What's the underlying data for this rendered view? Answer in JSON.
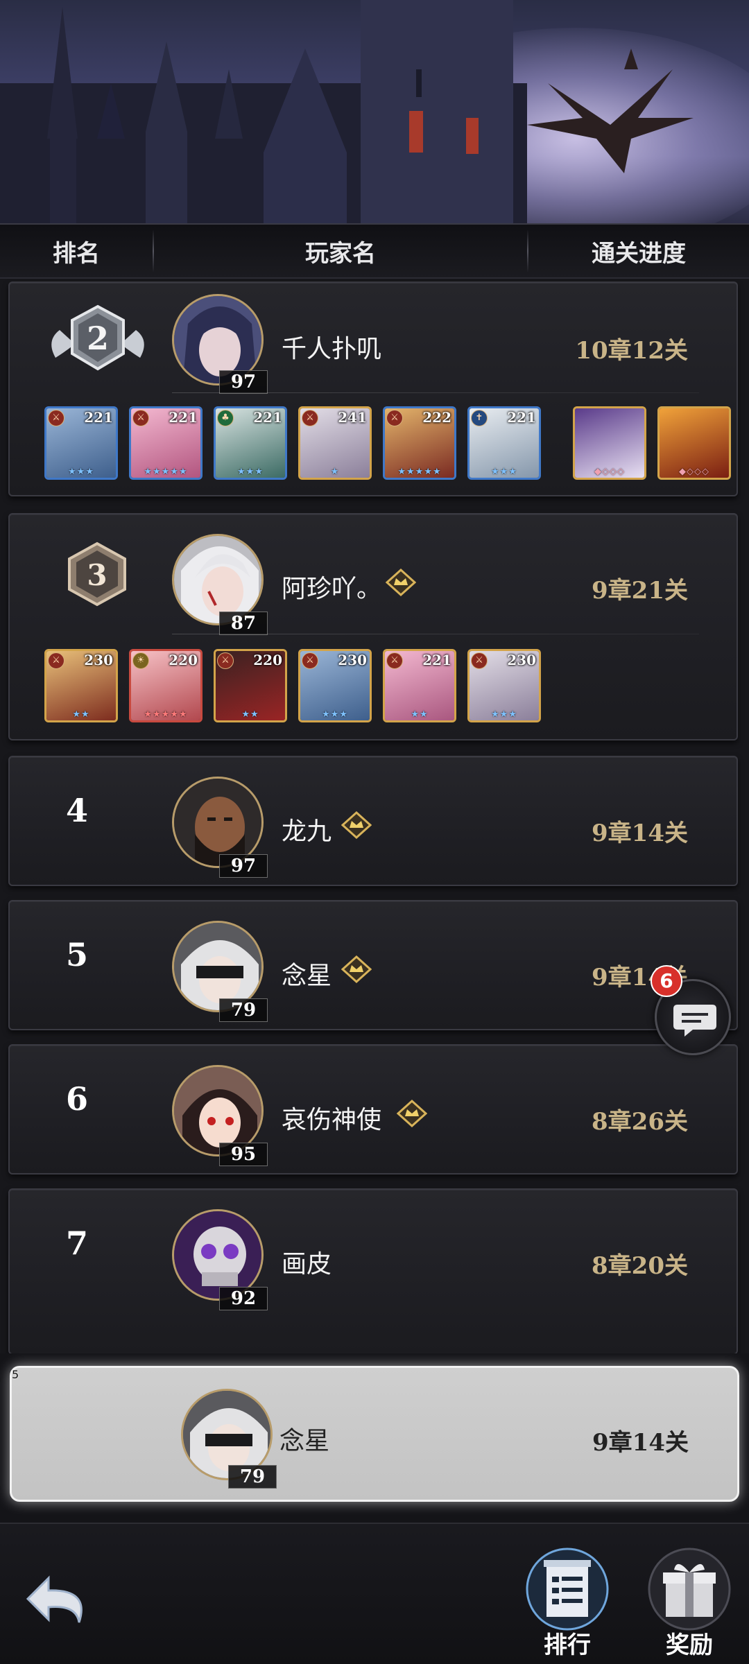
{
  "header": {
    "col_rank": "排名",
    "col_player": "玩家名",
    "col_progress": "通关进度"
  },
  "rows": [
    {
      "rank": "2",
      "name": "千人扑叽",
      "level": "97",
      "progress": "10章12关",
      "vip": false,
      "heroes": [
        {
          "lvl": "221",
          "stars": "★★★"
        },
        {
          "lvl": "221",
          "stars": "★★★★★"
        },
        {
          "lvl": "221",
          "stars": "★★★"
        },
        {
          "lvl": "241",
          "stars": "★"
        },
        {
          "lvl": "222",
          "stars": "★★★★★"
        },
        {
          "lvl": "221",
          "stars": "★★★"
        }
      ],
      "pets": [
        {
          "name": "pet-white-beast"
        },
        {
          "name": "pet-fire-beast"
        }
      ]
    },
    {
      "rank": "3",
      "name": "阿珍吖。",
      "level": "87",
      "progress": "9章21关",
      "vip": true,
      "heroes": [
        {
          "lvl": "230",
          "stars": "★★"
        },
        {
          "lvl": "220",
          "stars": "★★★★★"
        },
        {
          "lvl": "220",
          "stars": "★★"
        },
        {
          "lvl": "230",
          "stars": "★★★"
        },
        {
          "lvl": "221",
          "stars": "★★"
        },
        {
          "lvl": "230",
          "stars": "★★★"
        }
      ]
    },
    {
      "rank": "4",
      "name": "龙九",
      "level": "97",
      "progress": "9章14关",
      "vip": true
    },
    {
      "rank": "5",
      "name": "念星",
      "level": "79",
      "progress": "9章14关",
      "vip": true
    },
    {
      "rank": "6",
      "name": "哀伤神使",
      "level": "95",
      "progress": "8章26关",
      "vip": true
    },
    {
      "rank": "7",
      "name": "画皮",
      "level": "92",
      "progress": "8章20关",
      "vip": false
    }
  ],
  "self": {
    "rank": "5",
    "name": "念星",
    "level": "79",
    "progress": "9章14关"
  },
  "chat": {
    "badge": "6"
  },
  "nav": {
    "ranking_label": "排行",
    "rewards_label": "奖励"
  },
  "colors": {
    "progress_gold": "#c9b488",
    "avatar_border": "#b89c6a",
    "badge_red": "#d8302a"
  }
}
